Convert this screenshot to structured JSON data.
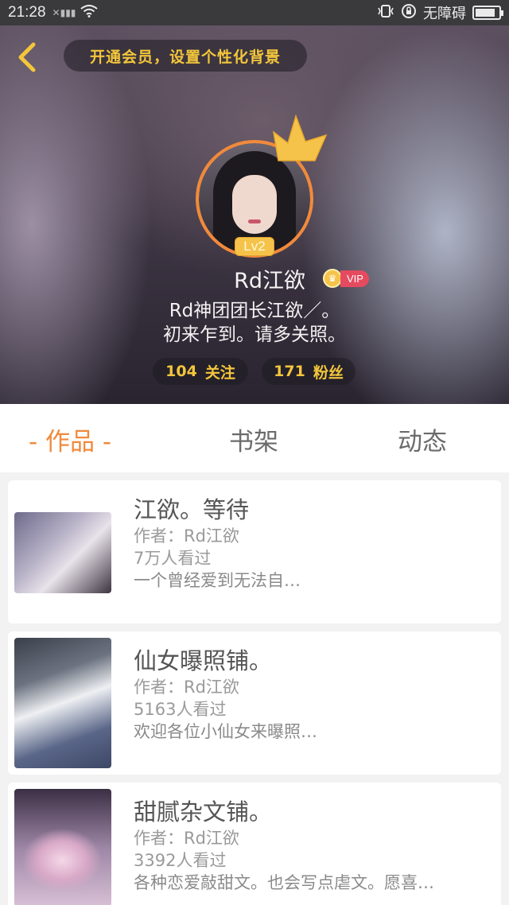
{
  "status_bar": {
    "time": "21:28",
    "accessibility_text": "无障碍",
    "battery_level": 0.85
  },
  "header": {
    "vip_banner": "开通会员，设置个性化背景",
    "level_badge": "Lv2",
    "username": "Rd江欲",
    "vip_label": "VIP",
    "bio_line1": "Rd神团团长江欲／。",
    "bio_line2": "初来乍到。请多关照。",
    "following_count": "104",
    "following_label": "关注",
    "followers_count": "171",
    "followers_label": "粉丝"
  },
  "tabs": [
    {
      "label": "- 作品 -",
      "active": true
    },
    {
      "label": "书架",
      "active": false
    },
    {
      "label": "动态",
      "active": false
    }
  ],
  "works": [
    {
      "title": "江欲。等待",
      "author": "作者：Rd江欲",
      "views": "7万人看过",
      "desc": "一个曾经爱到无法自…"
    },
    {
      "title": "仙女曝照铺。",
      "author": "作者：Rd江欲",
      "views": "5163人看过",
      "desc": "欢迎各位小仙女来曝照…"
    },
    {
      "title": "甜腻杂文铺。",
      "author": "作者：Rd江欲",
      "views": "3392人看过",
      "desc": "各种恋爱敲甜文。也会写点虐文。愿喜…"
    }
  ],
  "colors": {
    "accent": "#f08a3c",
    "gold": "#f3c63b",
    "vip_red": "#e54a5f"
  }
}
